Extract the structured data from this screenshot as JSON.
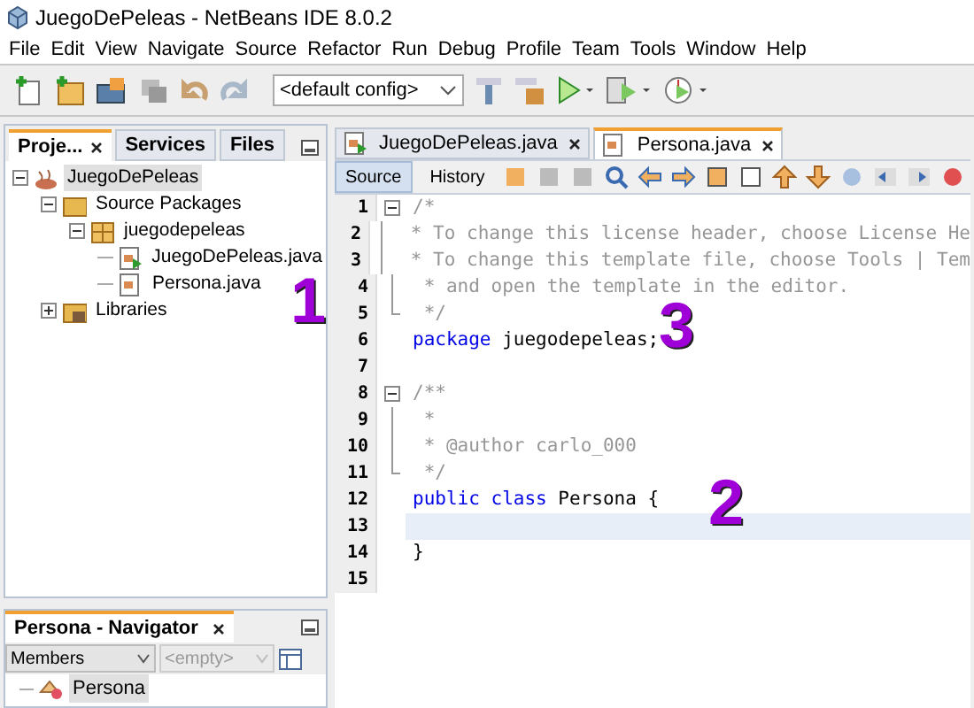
{
  "window": {
    "title": "JuegoDePeleas - NetBeans IDE 8.0.2"
  },
  "menu": [
    "File",
    "Edit",
    "View",
    "Navigate",
    "Source",
    "Refactor",
    "Run",
    "Debug",
    "Profile",
    "Team",
    "Tools",
    "Window",
    "Help"
  ],
  "toolbar": {
    "config": "<default config>"
  },
  "projects_panel": {
    "tabs": [
      {
        "label": "Proje...",
        "selected": true,
        "closable": true
      },
      {
        "label": "Services",
        "selected": false,
        "closable": false
      },
      {
        "label": "Files",
        "selected": false,
        "closable": false
      }
    ],
    "tree": [
      {
        "label": "JuegoDePeleas",
        "kind": "project",
        "expanded": true,
        "selected": true,
        "children": [
          {
            "label": "Source Packages",
            "kind": "folder",
            "expanded": true,
            "selected": false,
            "children": [
              {
                "label": "juegodepeleas",
                "kind": "package",
                "expanded": true,
                "selected": false,
                "children": [
                  {
                    "label": "JuegoDePeleas.java",
                    "kind": "mainclass",
                    "selected": false
                  },
                  {
                    "label": "Persona.java",
                    "kind": "class",
                    "selected": false
                  }
                ]
              }
            ]
          },
          {
            "label": "Libraries",
            "kind": "library",
            "expanded": false,
            "selected": false
          }
        ]
      }
    ]
  },
  "navigator": {
    "title": "Persona - Navigator",
    "filter": "Members",
    "filter2": "<empty>",
    "items": [
      {
        "label": "Persona",
        "selected": true
      }
    ]
  },
  "editor": {
    "tabs": [
      {
        "label": "JuegoDePeleas.java",
        "selected": false,
        "kind": "mainclass"
      },
      {
        "label": "Persona.java",
        "selected": true,
        "kind": "class"
      }
    ],
    "views": [
      {
        "label": "Source",
        "selected": true
      },
      {
        "label": "History",
        "selected": false
      }
    ],
    "lines": [
      {
        "number": "1",
        "kind": "foldstart",
        "current": false,
        "parts": [
          {
            "kind": "comment",
            "text": "/*"
          }
        ]
      },
      {
        "number": "2",
        "kind": "foldbody",
        "current": false,
        "parts": [
          {
            "kind": "comment",
            "text": " * To change this license header, choose License He"
          }
        ]
      },
      {
        "number": "3",
        "kind": "foldbody",
        "current": false,
        "parts": [
          {
            "kind": "comment",
            "text": " * To change this template file, choose Tools | Tem"
          }
        ]
      },
      {
        "number": "4",
        "kind": "foldbody",
        "current": false,
        "parts": [
          {
            "kind": "comment",
            "text": " * and open the template in the editor."
          }
        ]
      },
      {
        "number": "5",
        "kind": "foldend",
        "current": false,
        "parts": [
          {
            "kind": "comment",
            "text": " */"
          }
        ]
      },
      {
        "number": "6",
        "kind": "code",
        "current": false,
        "parts": [
          {
            "kind": "keyword",
            "text": "package"
          },
          {
            "kind": "plain",
            "text": " juegodepeleas;"
          }
        ]
      },
      {
        "number": "7",
        "kind": "code",
        "current": false
      },
      {
        "number": "8",
        "kind": "foldstart",
        "current": false,
        "parts": [
          {
            "kind": "comment",
            "text": "/**"
          }
        ]
      },
      {
        "number": "9",
        "kind": "foldbody",
        "current": false,
        "parts": [
          {
            "kind": "comment",
            "text": " *"
          }
        ]
      },
      {
        "number": "10",
        "kind": "foldbody",
        "current": false,
        "parts": [
          {
            "kind": "comment",
            "text": " * @author carlo_000"
          }
        ]
      },
      {
        "number": "11",
        "kind": "foldend",
        "current": false,
        "parts": [
          {
            "kind": "comment",
            "text": " */"
          }
        ]
      },
      {
        "number": "12",
        "kind": "code",
        "current": false,
        "parts": [
          {
            "kind": "keyword",
            "text": "public class"
          },
          {
            "kind": "plain",
            "text": " Persona {"
          }
        ]
      },
      {
        "number": "13",
        "kind": "code",
        "current": true
      },
      {
        "number": "14",
        "kind": "code",
        "current": false,
        "parts": [
          {
            "kind": "plain",
            "text": "}"
          }
        ]
      },
      {
        "number": "15",
        "kind": "code",
        "current": false
      }
    ]
  },
  "annotations": [
    {
      "text": "1"
    },
    {
      "text": "3"
    },
    {
      "text": "2"
    }
  ]
}
